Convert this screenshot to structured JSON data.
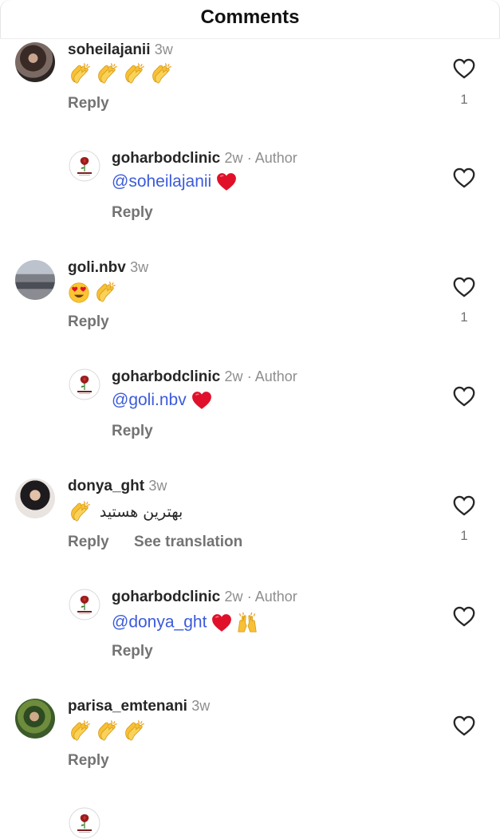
{
  "header": {
    "title": "Comments"
  },
  "comments": [
    {
      "username": "soheilajanii",
      "time": "3w",
      "author_tag": "",
      "text": "",
      "reply": "Reply",
      "translate": "",
      "likes": "1"
    },
    {
      "username": "goharbodclinic",
      "time": "2w",
      "author_tag": "· Author",
      "mention": "@soheilajanii",
      "reply": "Reply",
      "likes": ""
    },
    {
      "username": "goli.nbv",
      "time": "3w",
      "author_tag": "",
      "text": "",
      "reply": "Reply",
      "translate": "",
      "likes": "1"
    },
    {
      "username": "goharbodclinic",
      "time": "2w",
      "author_tag": "· Author",
      "mention": "@goli.nbv",
      "reply": "Reply",
      "likes": ""
    },
    {
      "username": "donya_ght",
      "time": "3w",
      "author_tag": "",
      "text": "بهترین هستید",
      "reply": "Reply",
      "translate": "See translation",
      "likes": "1"
    },
    {
      "username": "goharbodclinic",
      "time": "2w",
      "author_tag": "· Author",
      "mention": "@donya_ght",
      "reply": "Reply",
      "likes": ""
    },
    {
      "username": "parisa_emtenani",
      "time": "3w",
      "author_tag": "",
      "text": "",
      "reply": "Reply",
      "translate": "",
      "likes": ""
    }
  ],
  "icons": {
    "like": "heart-outline-icon",
    "red_heart": "red-heart-emoji",
    "clap": "clapping-hands-emoji",
    "heart_eyes": "heart-eyes-emoji",
    "raised_hands": "raised-hands-emoji"
  },
  "colors": {
    "mention": "#3b5bdb",
    "secondary": "#737373",
    "heart": "#e0102b"
  }
}
